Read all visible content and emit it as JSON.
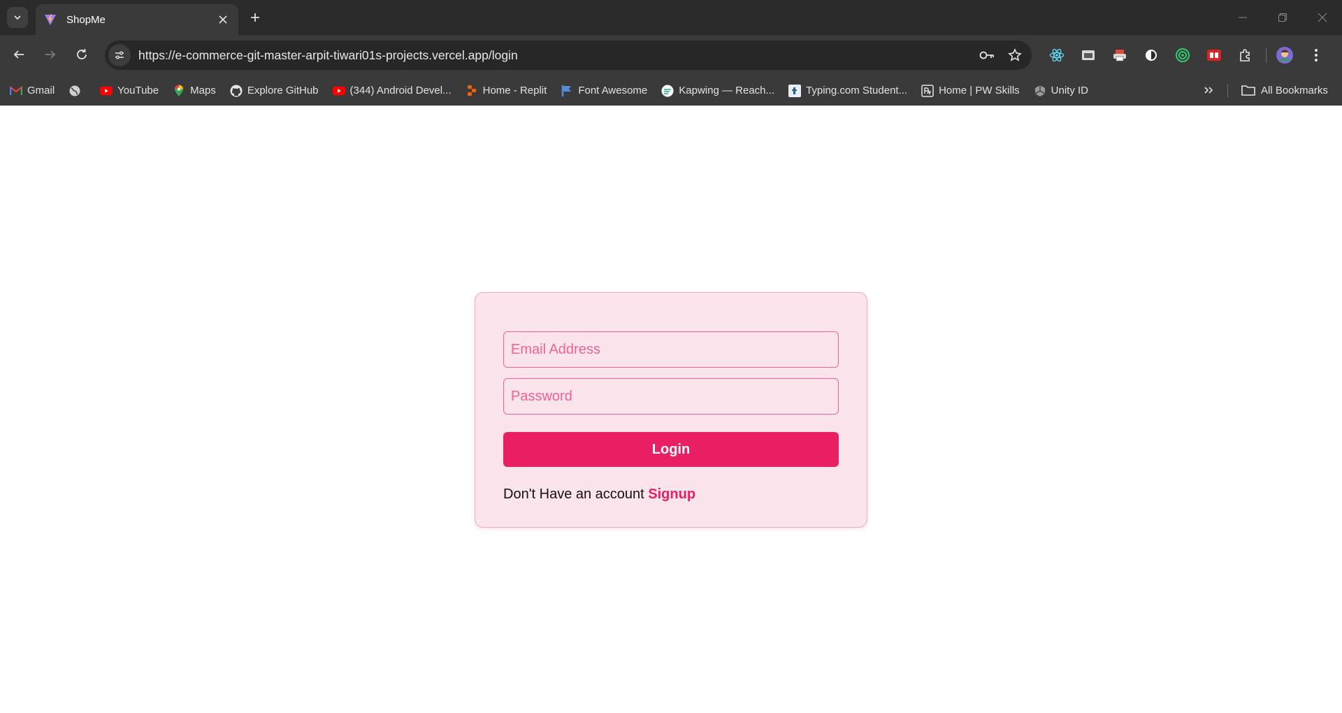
{
  "browser": {
    "tab": {
      "title": "ShopMe"
    },
    "url": "https://e-commerce-git-master-arpit-tiwari01s-projects.vercel.app/login",
    "bookmarks": [
      {
        "label": "Gmail",
        "icon": "gmail-icon"
      },
      {
        "label": "",
        "icon": "globe-icon"
      },
      {
        "label": "YouTube",
        "icon": "youtube-icon"
      },
      {
        "label": "Maps",
        "icon": "maps-icon"
      },
      {
        "label": "Explore GitHub",
        "icon": "github-icon"
      },
      {
        "label": "(344) Android Devel...",
        "icon": "youtube-icon"
      },
      {
        "label": "Home - Replit",
        "icon": "replit-icon"
      },
      {
        "label": "Font Awesome",
        "icon": "flag-icon"
      },
      {
        "label": "Kapwing — Reach...",
        "icon": "kapwing-icon"
      },
      {
        "label": "Typing.com Student...",
        "icon": "typing-icon"
      },
      {
        "label": "Home | PW Skills",
        "icon": "pw-skills-icon"
      },
      {
        "label": "Unity ID",
        "icon": "unity-icon"
      }
    ],
    "all_bookmarks": "All Bookmarks"
  },
  "login": {
    "email_placeholder": "Email Address",
    "password_placeholder": "Password",
    "button_label": "Login",
    "signup_prompt": "Don't Have an account",
    "signup_link": "Signup"
  },
  "colors": {
    "accent": "#e91e63",
    "card_background": "#fce4ec",
    "input_border": "#f06292"
  }
}
